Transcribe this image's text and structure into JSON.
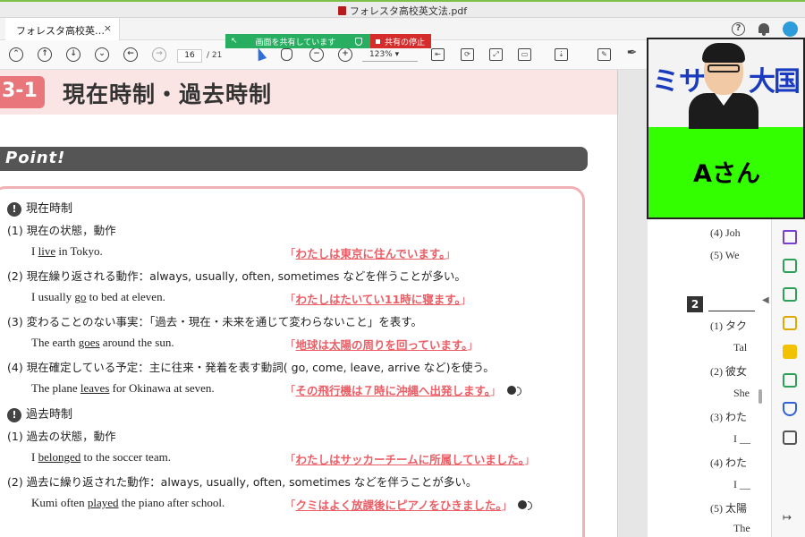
{
  "window": {
    "title": "フォレスタ高校英文法.pdf"
  },
  "tabs": [
    {
      "label": "フォレスタ高校英…",
      "close": "×"
    }
  ],
  "screen_share": {
    "status": "画面を共有しています",
    "stop_label": "共有の停止"
  },
  "toolbar": {
    "current_page": "16",
    "total_pages": "/ 21",
    "zoom": "123%"
  },
  "document": {
    "lesson_number": "3-1",
    "lesson_title": "現在時制・過去時制",
    "point_label": "Point!",
    "sections": [
      {
        "heading": "現在時制",
        "items": [
          {
            "label": "(1) 現在の状態，動作",
            "example_pre": "I ",
            "example_word": "live",
            "example_post": " in Tokyo.",
            "translation": "わたしは東京に住んでいます。",
            "audio": false
          },
          {
            "label": "(2) 現在繰り返される動作：always, usually, often, sometimes などを伴うことが多い。",
            "example_pre": "I usually ",
            "example_word": "go",
            "example_post": " to bed at eleven.",
            "translation": "わたしはたいてい11時に寝ます。",
            "audio": false
          },
          {
            "label": "(3) 変わることのない事実：「過去・現在・未来を通じて変わらないこと」を表す。",
            "example_pre": "The earth ",
            "example_word": "goes",
            "example_post": " around the sun.",
            "translation": "地球は太陽の周りを回っています。",
            "audio": false
          },
          {
            "label": "(4) 現在確定している予定：主に往来・発着を表す動詞( go, come, leave, arrive など)を使う。",
            "example_pre": "The plane ",
            "example_word": "leaves",
            "example_post": " for Okinawa at seven.",
            "translation": "その飛行機は７時に沖縄へ出発します。",
            "audio": true
          }
        ]
      },
      {
        "heading": "過去時制",
        "items": [
          {
            "label": "(1) 過去の状態，動作",
            "example_pre": "I ",
            "example_word": "belonged",
            "example_post": " to the soccer team.",
            "translation": "わたしはサッカーチームに所属していました。",
            "audio": false
          },
          {
            "label": "(2) 過去に繰り返された動作：always, usually, often, sometimes などを伴うことが多い。",
            "example_pre": "Kumi often ",
            "example_word": "played",
            "example_post": " the piano after school.",
            "translation": "クミはよく放課後にピアノをひきました。",
            "audio": true
          }
        ]
      }
    ]
  },
  "right_page": {
    "lines": [
      "(4) Joh",
      "(5) We",
      "(1) タク",
      "Tal",
      "(2) 彼女",
      "She",
      "(3) わた",
      "I __",
      "(4) わた",
      "I __",
      "(5) 太陽",
      "The"
    ],
    "badge": "2"
  },
  "webcam": {
    "logo_left": "ミ",
    "logo_mid": "サ",
    "logo_right": "大国",
    "participant_name": "Aさん"
  },
  "colors": {
    "accent_pink": "#ec5e66",
    "share_green": "#27ae60",
    "share_red": "#d62b2b",
    "cam_green": "#33ff00"
  }
}
